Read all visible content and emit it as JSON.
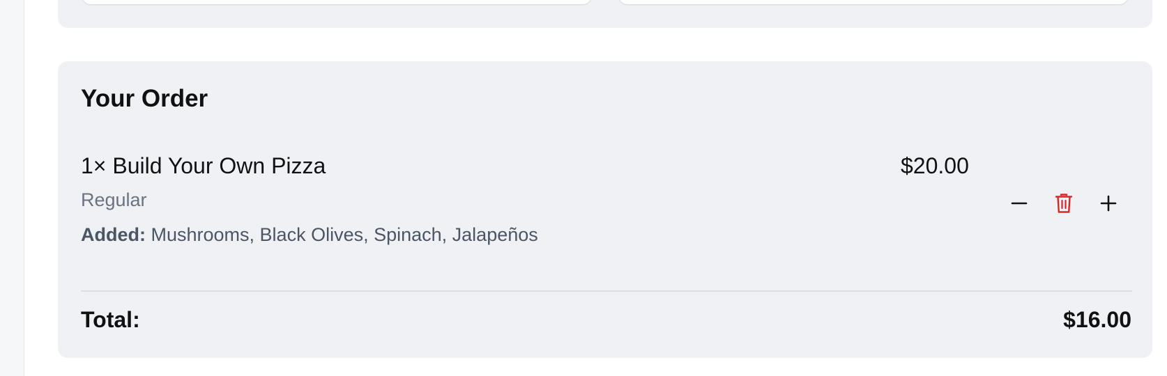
{
  "order": {
    "title": "Your Order",
    "items": [
      {
        "name": "1× Build Your Own Pizza",
        "price": "$20.00",
        "size": "Regular",
        "added_label": "Added:",
        "added_list": "Mushrooms, Black Olives, Spinach, Jalapeños",
        "controls": [
          {
            "name": "decrease-quantity",
            "icon": "minus-icon"
          },
          {
            "name": "remove-item",
            "icon": "trash-icon"
          },
          {
            "name": "increase-quantity",
            "icon": "plus-icon"
          }
        ]
      }
    ],
    "total_label": "Total:",
    "total_value": "$16.00"
  },
  "colors": {
    "panel_bg": "#f0f1f5",
    "text_primary": "#111111",
    "text_secondary": "#6b7280",
    "danger": "#dc2626",
    "divider": "#dcdee3"
  }
}
